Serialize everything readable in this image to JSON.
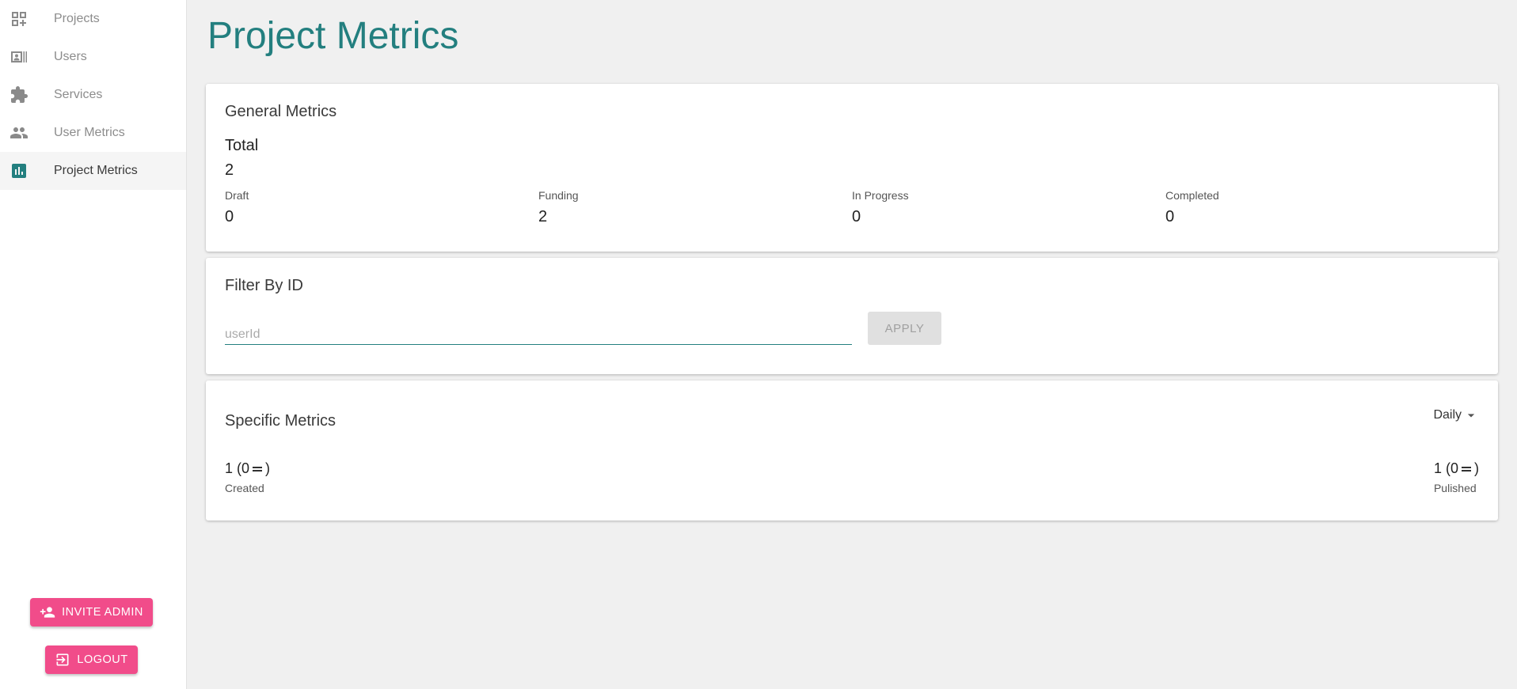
{
  "sidebar": {
    "items": [
      {
        "label": "Projects",
        "icon": "dashboard-customize-icon",
        "active": false
      },
      {
        "label": "Users",
        "icon": "badge-list-icon",
        "active": false
      },
      {
        "label": "Services",
        "icon": "puzzle-icon",
        "active": false
      },
      {
        "label": "User Metrics",
        "icon": "people-icon",
        "active": false
      },
      {
        "label": "Project Metrics",
        "icon": "bar-chart-icon",
        "active": true
      }
    ],
    "invite_label": "INVITE ADMIN",
    "logout_label": "LOGOUT"
  },
  "page": {
    "title": "Project Metrics"
  },
  "general": {
    "title": "General Metrics",
    "total_label": "Total",
    "total_value": "2",
    "stats": [
      {
        "label": "Draft",
        "value": "0"
      },
      {
        "label": "Funding",
        "value": "2"
      },
      {
        "label": "In Progress",
        "value": "0"
      },
      {
        "label": "Completed",
        "value": "0"
      }
    ]
  },
  "filter": {
    "title": "Filter By ID",
    "placeholder": "userId",
    "value": "",
    "apply_label": "APPLY"
  },
  "specific": {
    "title": "Specific Metrics",
    "period": "Daily",
    "stats": [
      {
        "count": "1",
        "delta_open": "(0",
        "delta_close": ")",
        "label": "Created"
      },
      {
        "count": "1",
        "delta_open": "(0",
        "delta_close": ")",
        "label": "Pulished"
      }
    ]
  },
  "colors": {
    "accent": "#237f7f",
    "button": "#f14c8a",
    "background": "#f0f0f0"
  }
}
